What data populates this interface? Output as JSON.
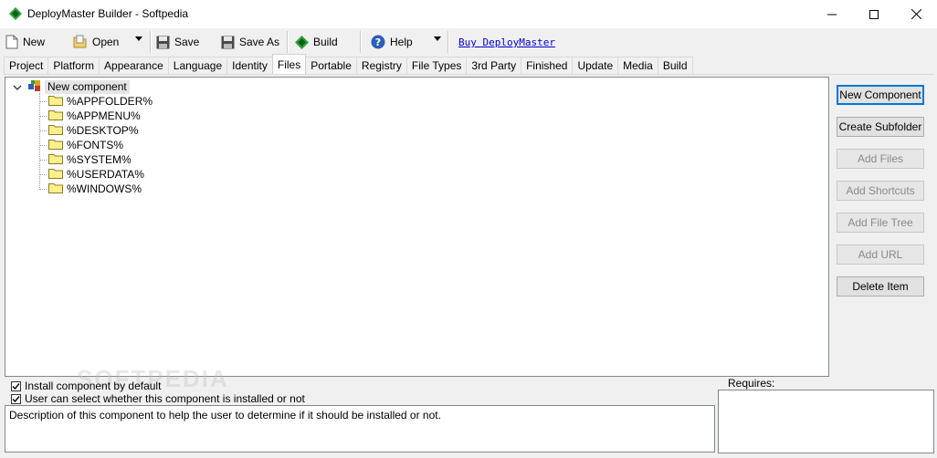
{
  "window": {
    "title": "DeployMaster Builder - Softpedia"
  },
  "toolbar": {
    "new": "New",
    "open": "Open",
    "save": "Save",
    "save_as": "Save As",
    "build": "Build",
    "help": "Help",
    "buy": "Buy DeployMaster"
  },
  "tabs": [
    "Project",
    "Platform",
    "Appearance",
    "Language",
    "Identity",
    "Files",
    "Portable",
    "Registry",
    "File Types",
    "3rd Party",
    "Finished",
    "Update",
    "Media",
    "Build"
  ],
  "active_tab": "Files",
  "tree": {
    "root": "New component",
    "children": [
      "%APPFOLDER%",
      "%APPMENU%",
      "%DESKTOP%",
      "%FONTS%",
      "%SYSTEM%",
      "%USERDATA%",
      "%WINDOWS%"
    ]
  },
  "actions": {
    "new_component": "New Component",
    "create_subfolder": "Create Subfolder",
    "add_files": "Add Files",
    "add_shortcuts": "Add Shortcuts",
    "add_file_tree": "Add File Tree",
    "add_url": "Add URL",
    "delete_item": "Delete Item"
  },
  "options": {
    "install_default": "Install component by default",
    "user_select": "User can select whether this component is installed or not"
  },
  "description": "Description of this component to help the user to determine if it should be installed or not.",
  "requires_label": "Requires:",
  "watermark": "SOFTPEDIA"
}
